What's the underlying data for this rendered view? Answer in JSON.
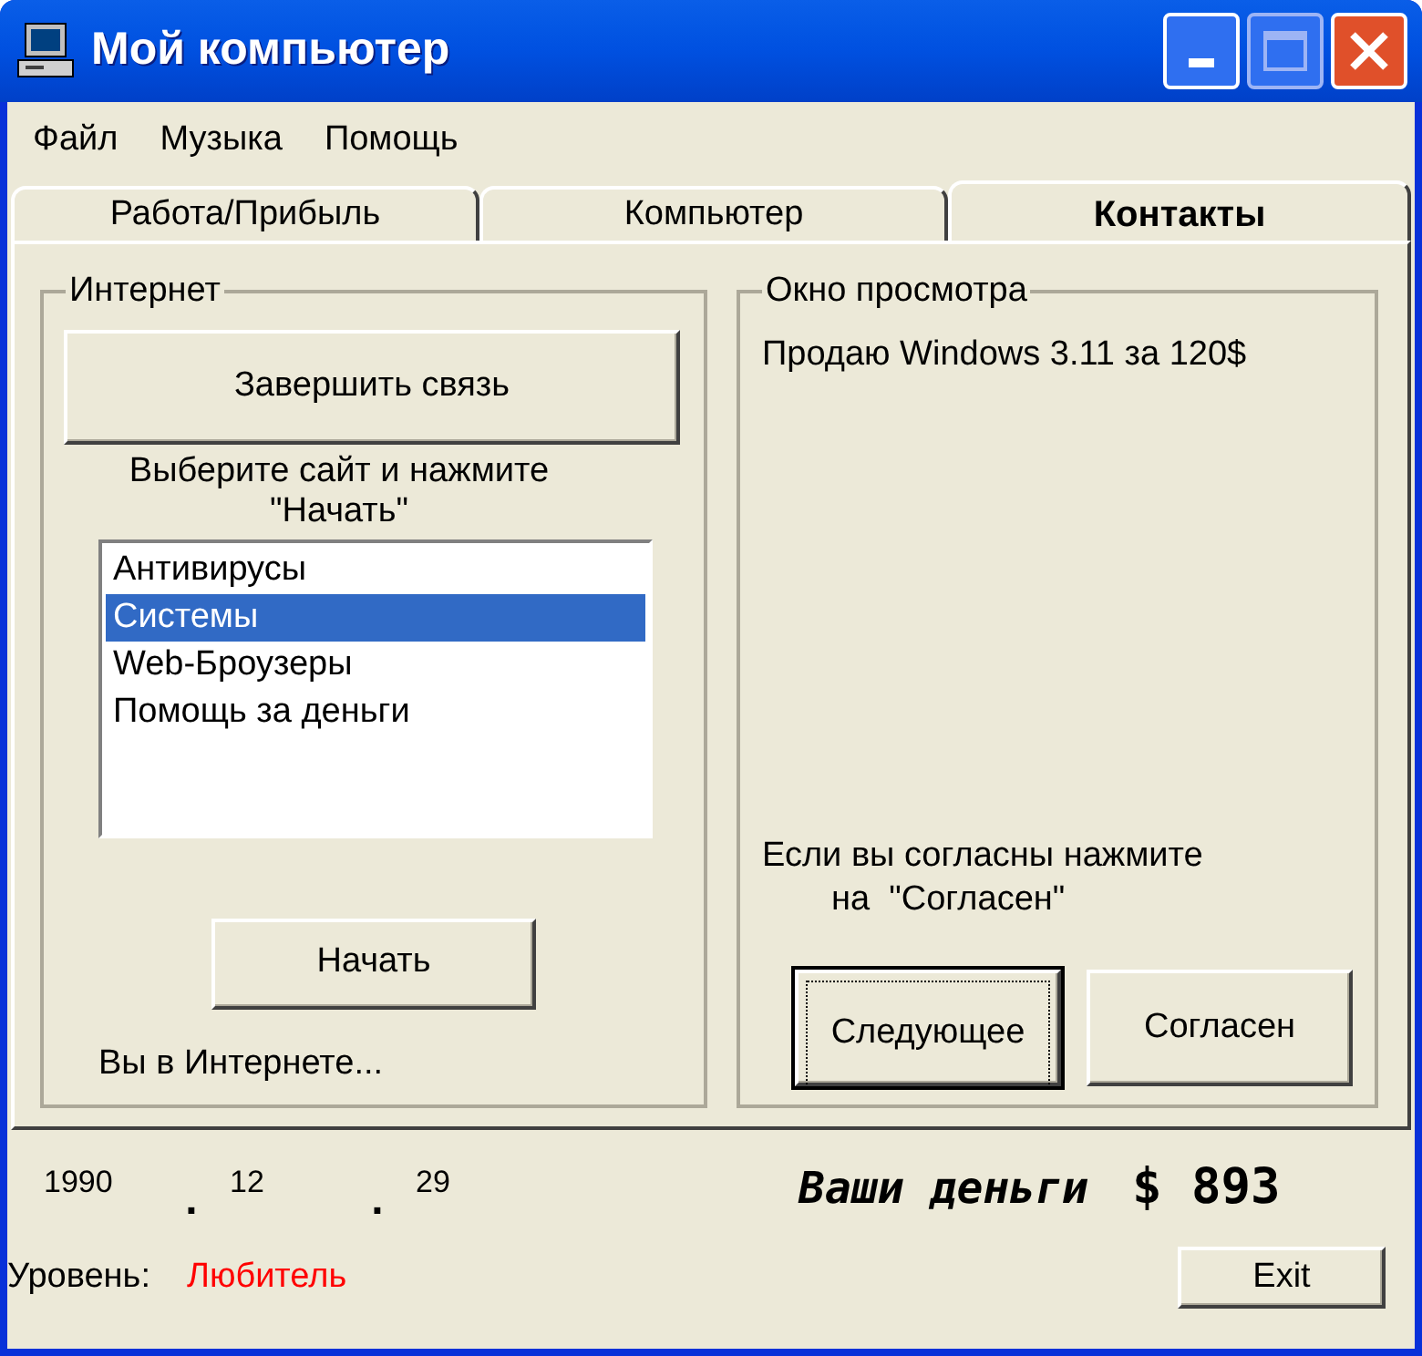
{
  "window": {
    "title": "Мой компьютер"
  },
  "menu": [
    "Файл",
    "Музыка",
    "Помощь"
  ],
  "tabs": [
    {
      "label": "Работа/Прибыль",
      "selected": false
    },
    {
      "label": "Компьютер",
      "selected": false
    },
    {
      "label": "Контакты",
      "selected": true
    }
  ],
  "internet": {
    "title": "Интернет",
    "disconnect_button": "Завершить связь",
    "instruction": [
      "Выберите сайт и нажмите",
      "\"Начать\""
    ],
    "sites": [
      {
        "label": "Антивирусы",
        "selected": false
      },
      {
        "label": "Системы",
        "selected": true
      },
      {
        "label": "Web-Броузеры",
        "selected": false
      },
      {
        "label": "Помощь за деньги",
        "selected": false
      }
    ],
    "start_button": "Начать",
    "status": "Вы в Интернете..."
  },
  "preview": {
    "title": "Окно просмотра",
    "message": "Продаю Windows 3.11 за 120$",
    "prompt": [
      "Если вы согласны нажмите",
      "на  \"Согласен\""
    ],
    "buttons": [
      {
        "label": "Следующее",
        "focused": true
      },
      {
        "label": "Согласен",
        "focused": false
      }
    ]
  },
  "date": [
    "1990",
    ".",
    "12",
    ".",
    "29"
  ],
  "money": {
    "label": "Ваши деньги",
    "amount": "$ 893"
  },
  "level": {
    "label": "Уровень:",
    "value": "Любитель"
  },
  "exit_button": "Exit"
}
